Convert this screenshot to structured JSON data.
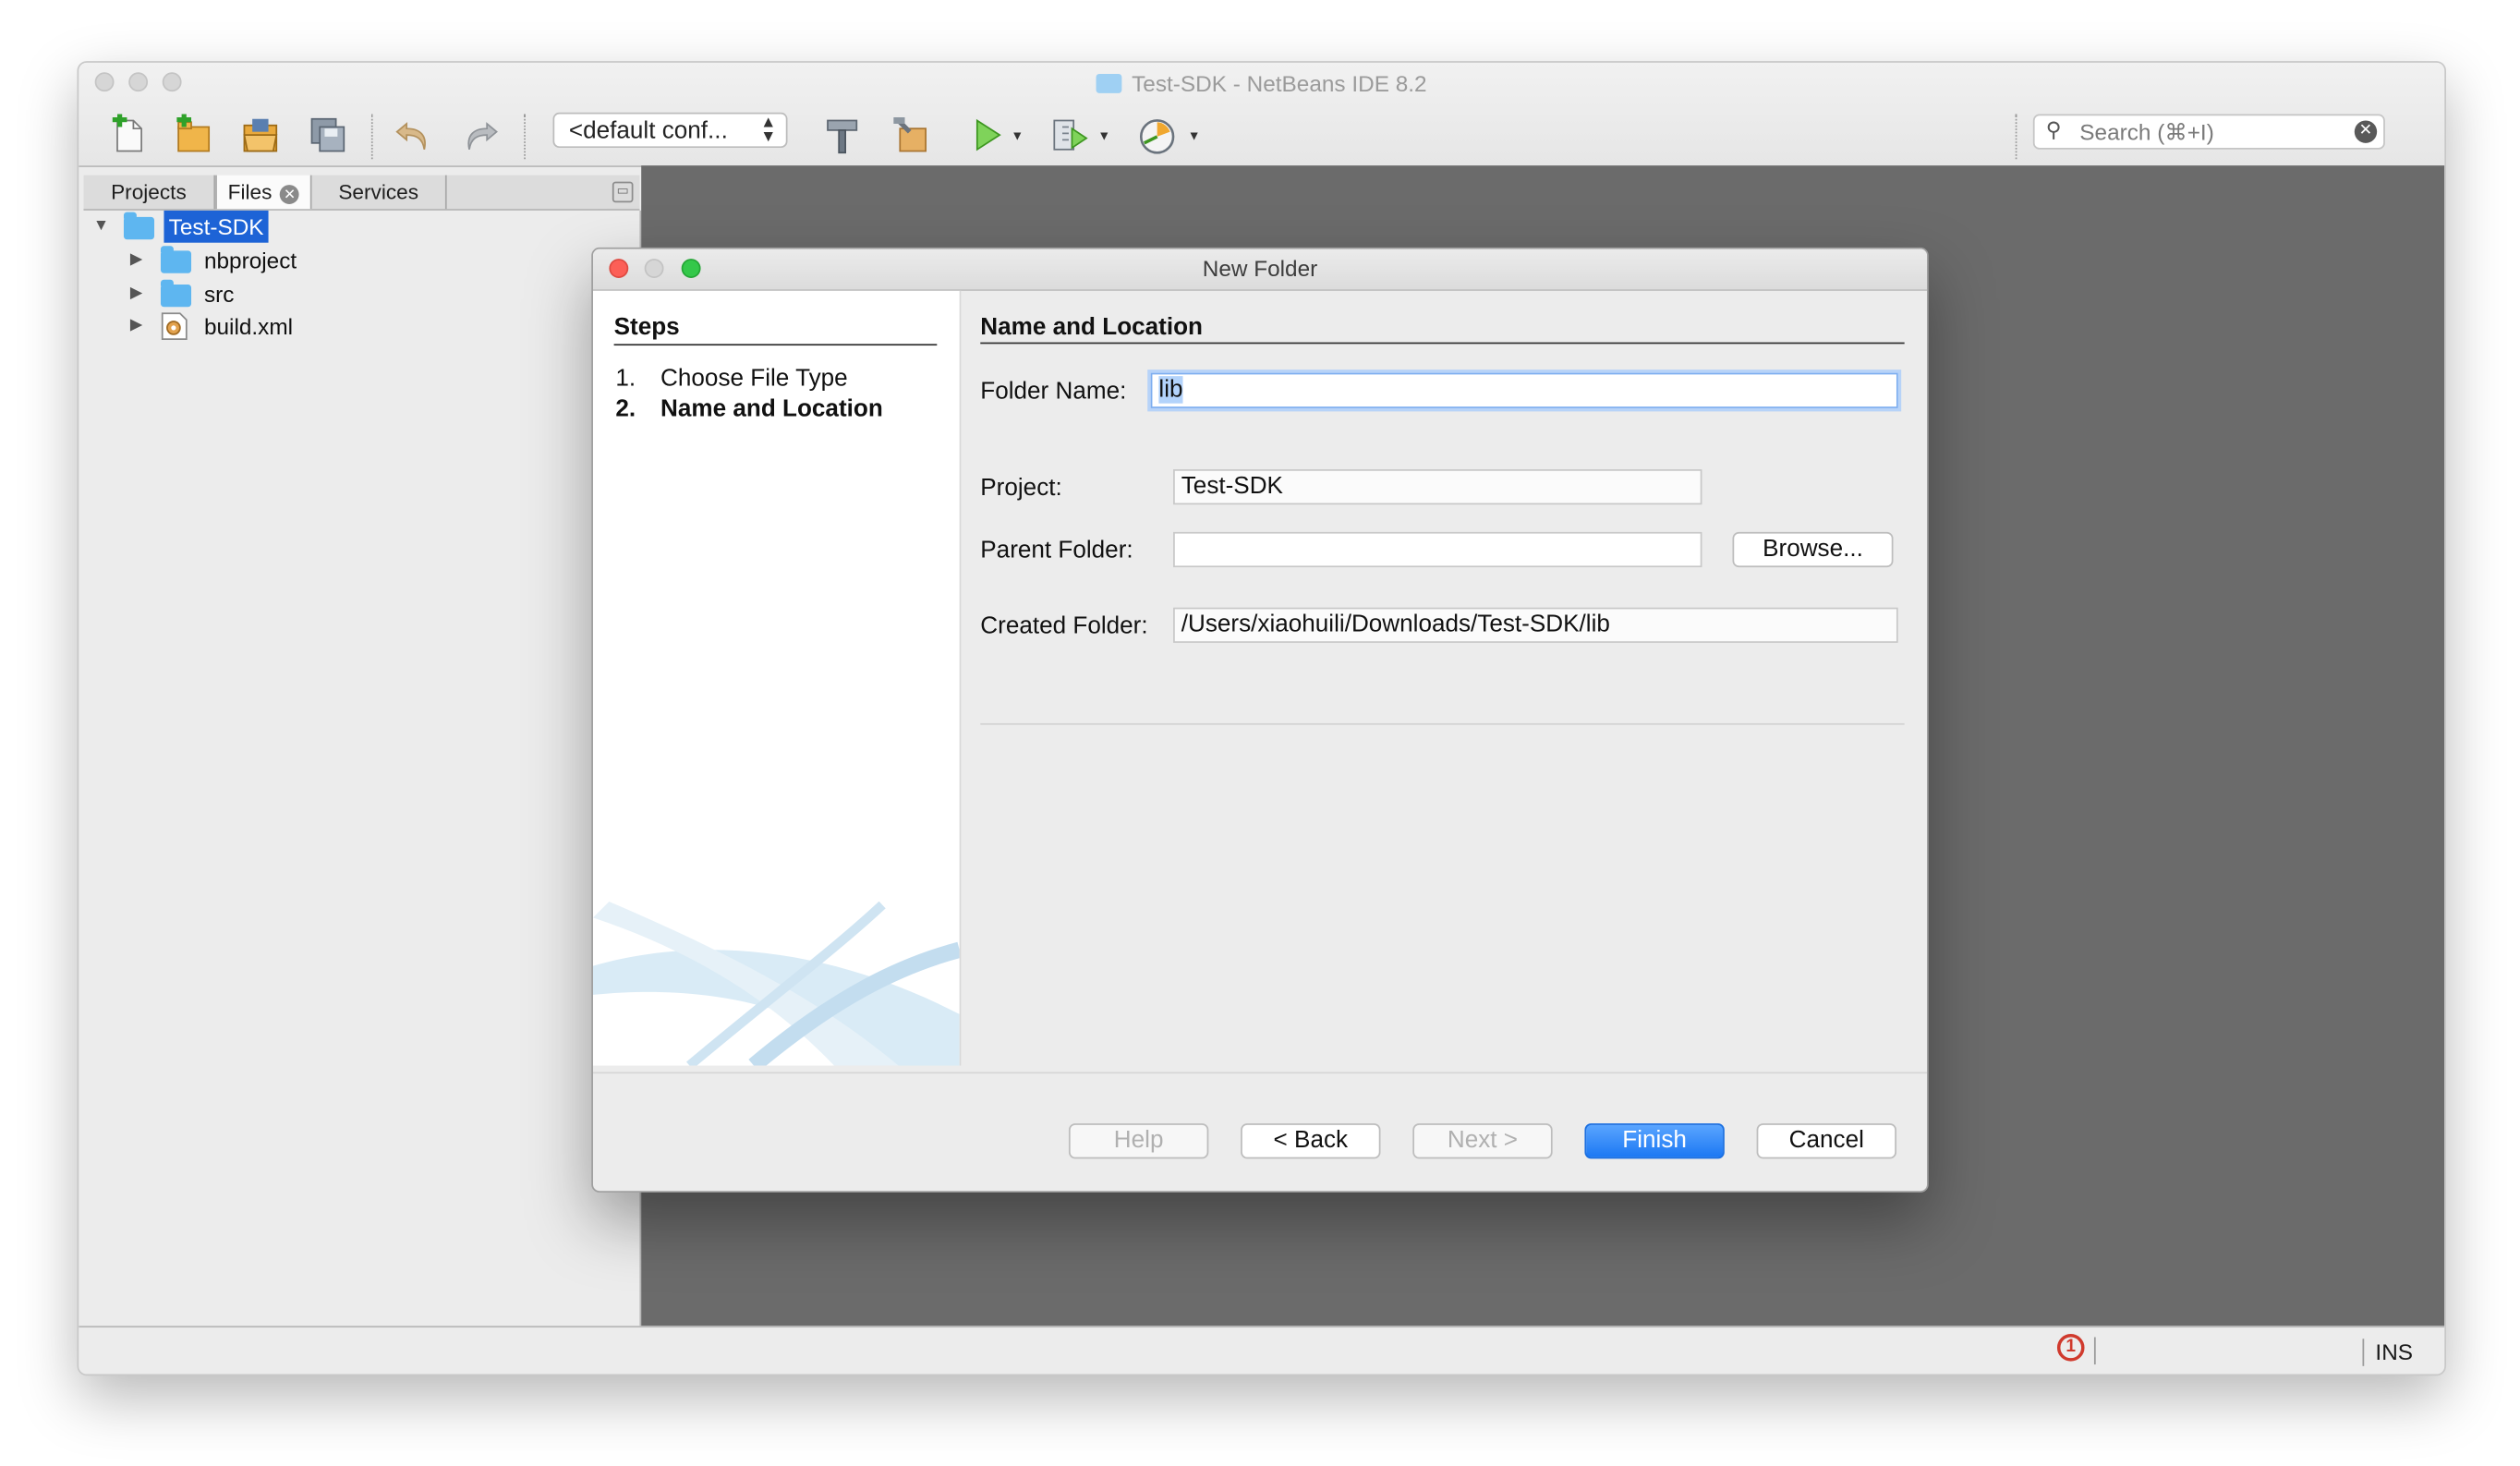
{
  "window": {
    "title": "Test-SDK - NetBeans IDE 8.2"
  },
  "toolbar": {
    "config_combo": "<default conf...",
    "search_placeholder": "Search (⌘+I)",
    "icons": [
      "new-file-icon",
      "new-project-icon",
      "open-project-icon",
      "save-all-icon",
      "undo-icon",
      "redo-icon",
      "build-hammer-icon",
      "clean-build-icon",
      "run-icon",
      "debug-icon",
      "profile-icon"
    ]
  },
  "panel": {
    "tabs": [
      "Projects",
      "Files",
      "Services"
    ],
    "active_tab": "Files",
    "tree": {
      "root": "Test-SDK",
      "children": [
        "nbproject",
        "src",
        "build.xml"
      ]
    }
  },
  "statusbar": {
    "insert_mode": "INS",
    "notification_count": "1"
  },
  "dialog": {
    "title": "New Folder",
    "steps_header": "Steps",
    "steps": [
      {
        "num": "1.",
        "label": "Choose File Type"
      },
      {
        "num": "2.",
        "label": "Name and Location"
      }
    ],
    "section_title": "Name and Location",
    "folder_name_label": "Folder Name:",
    "folder_name_value": "lib",
    "project_label": "Project:",
    "project_value": "Test-SDK",
    "parent_folder_label": "Parent Folder:",
    "parent_folder_value": "",
    "browse_label": "Browse...",
    "created_folder_label": "Created Folder:",
    "created_folder_value": "/Users/xiaohuili/Downloads/Test-SDK/lib",
    "buttons": {
      "help": "Help",
      "back": "< Back",
      "next": "Next >",
      "finish": "Finish",
      "cancel": "Cancel"
    }
  }
}
